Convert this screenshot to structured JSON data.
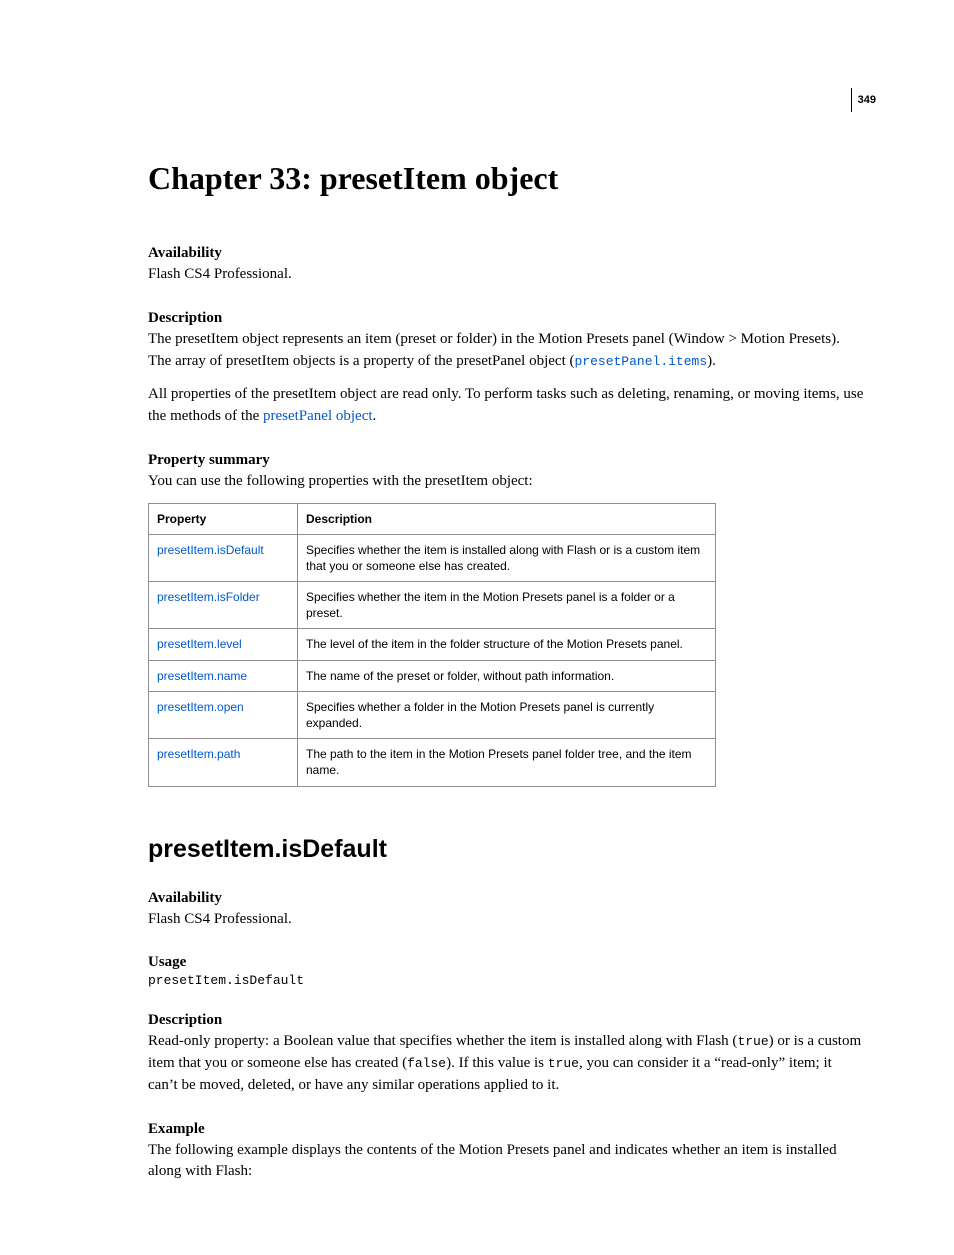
{
  "pageNumber": "349",
  "chapterTitle": "Chapter 33: presetItem object",
  "sec1": {
    "availabilityHead": "Availability",
    "availabilityBody": "Flash CS4 Professional.",
    "descriptionHead": "Description",
    "descPara1_a": "The presetItem object represents an item (preset or folder) in the Motion Presets panel (Window > Motion Presets). The array of presetItem objects is a property of the presetPanel object (",
    "descPara1_code": "presetPanel.items",
    "descPara1_b": ").",
    "descPara2_a": "All properties of the presetItem object are read only. To perform tasks such as deleting, renaming, or moving items, use the methods of the ",
    "descPara2_link": "presetPanel object",
    "descPara2_b": ".",
    "propSummaryHead": "Property summary",
    "propSummaryIntro": "You can use the following properties with the presetItem object:",
    "table": {
      "hProperty": "Property",
      "hDescription": "Description",
      "rows": [
        {
          "prop": "presetItem.isDefault",
          "desc": "Specifies whether the item is installed along with Flash or is a custom item that you or someone else has created."
        },
        {
          "prop": "presetItem.isFolder",
          "desc": "Specifies whether the item in the Motion Presets panel is a folder or a preset."
        },
        {
          "prop": "presetItem.level",
          "desc": "The level of the item in the folder structure of the Motion Presets panel."
        },
        {
          "prop": "presetItem.name",
          "desc": "The name of the preset or folder, without path information."
        },
        {
          "prop": "presetItem.open",
          "desc": "Specifies whether a folder in the Motion Presets panel is currently expanded."
        },
        {
          "prop": "presetItem.path",
          "desc": "The path to the item in the Motion Presets panel folder tree, and the item name."
        }
      ]
    }
  },
  "sec2": {
    "title": "presetItem.isDefault",
    "availabilityHead": "Availability",
    "availabilityBody": "Flash CS4 Professional.",
    "usageHead": "Usage",
    "usageCode": "presetItem.isDefault",
    "descriptionHead": "Description",
    "desc_a": "Read-only property: a Boolean value that specifies whether the item is installed along with Flash (",
    "desc_code1": "true",
    "desc_b": ") or is a custom item that you or someone else has created (",
    "desc_code2": "false",
    "desc_c": "). If this value is ",
    "desc_code3": "true",
    "desc_d": ", you can consider it a “read-only” item; it can’t be moved, deleted, or have any similar operations applied to it.",
    "exampleHead": "Example",
    "exampleBody": "The following example displays the contents of the Motion Presets panel and indicates whether an item is installed along with Flash:"
  }
}
